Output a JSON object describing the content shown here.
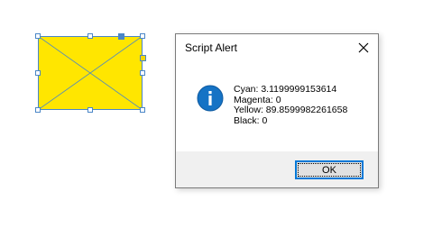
{
  "frame": {
    "fill_color": "#ffe600",
    "stroke_color": "#4a86c7"
  },
  "dialog": {
    "title": "Script Alert",
    "close_icon": "close-icon",
    "info_icon": "info-icon",
    "icon_color": "#1573c5",
    "message_lines": [
      "Cyan: 3.1199999153614",
      "Magenta: 0",
      "Yellow: 89.8599982261658",
      "Black: 0"
    ],
    "ok_label": "OK",
    "accent_color": "#0078d7"
  }
}
